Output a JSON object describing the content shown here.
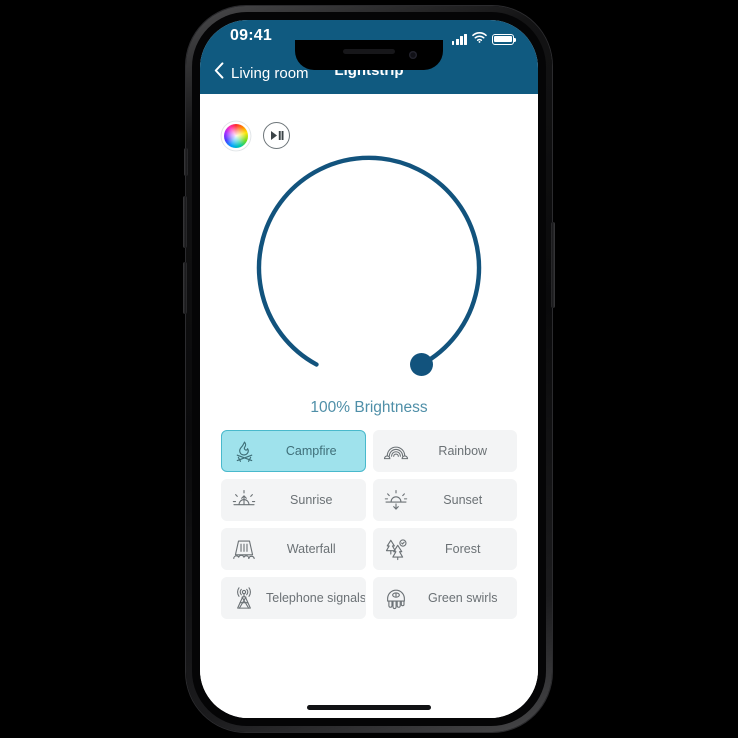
{
  "device": {
    "name": "smartphone-mockup",
    "frame_color": "#111214",
    "screen_bg": "#ffffff"
  },
  "status_bar": {
    "time": "09:41",
    "icons": [
      "signal-bars-icon",
      "wifi-icon",
      "battery-icon"
    ],
    "battery_level": "100"
  },
  "header": {
    "background_color": "#105A80",
    "back_label": "Living room",
    "back_icon": "chevron-left-icon",
    "title": "Lightstrip"
  },
  "quick_actions": [
    {
      "name": "color-wheel-button",
      "icon": "color-wheel-icon",
      "label": ""
    },
    {
      "name": "play-pause-button",
      "icon": "play-pause-icon",
      "label": ""
    }
  ],
  "brightness": {
    "value": 100,
    "label": "100% Brightness",
    "unit": "%",
    "arc_color": "#12537D",
    "handle_color": "#12537D",
    "label_color": "#4f8fa8",
    "min": 0,
    "max": 100
  },
  "scenes": {
    "selected": "Campfire",
    "selected_bg": "#9fe2ec",
    "selected_border": "#49b9cc",
    "tile_bg": "#f3f4f5",
    "items": [
      {
        "label": "Campfire",
        "icon": "campfire-icon",
        "selected": true
      },
      {
        "label": "Rainbow",
        "icon": "rainbow-icon",
        "selected": false
      },
      {
        "label": "Sunrise",
        "icon": "sunrise-icon",
        "selected": false
      },
      {
        "label": "Sunset",
        "icon": "sunset-icon",
        "selected": false
      },
      {
        "label": "Waterfall",
        "icon": "waterfall-icon",
        "selected": false
      },
      {
        "label": "Forest",
        "icon": "forest-icon",
        "selected": false
      },
      {
        "label": "Telephone signals",
        "icon": "antenna-icon",
        "selected": false
      },
      {
        "label": "Green swirls",
        "icon": "jellyfish-icon",
        "selected": false
      }
    ]
  }
}
